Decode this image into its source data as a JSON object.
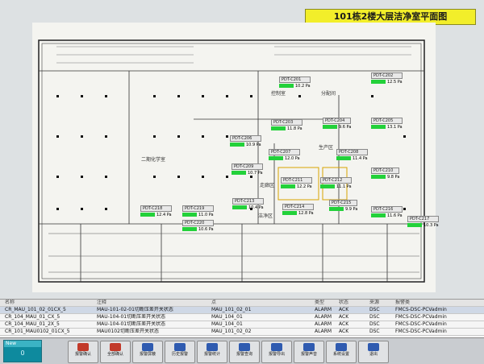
{
  "plan_title": "101栋2楼大层洁净室平面图",
  "rooms": [
    {
      "id": "r1",
      "label": "二期化学室"
    },
    {
      "id": "r2",
      "label": "控制室"
    },
    {
      "id": "r3",
      "label": "分配间"
    },
    {
      "id": "r4",
      "label": "生产区"
    },
    {
      "id": "r5",
      "label": "走廊区"
    },
    {
      "id": "r6",
      "label": "洁净区"
    }
  ],
  "sensors": [
    {
      "id": "PDT-C201",
      "value": "10.2 Pa"
    },
    {
      "id": "PDT-C202",
      "value": "12.5 Pa"
    },
    {
      "id": "PDT-C203",
      "value": "11.8 Pa"
    },
    {
      "id": "PDT-C204",
      "value": "9.6 Pa"
    },
    {
      "id": "PDT-C205",
      "value": "13.1 Pa"
    },
    {
      "id": "PDT-C206",
      "value": "10.9 Pa"
    },
    {
      "id": "PDT-C207",
      "value": "12.0 Pa"
    },
    {
      "id": "PDT-C208",
      "value": "11.4 Pa"
    },
    {
      "id": "PDT-C209",
      "value": "10.7 Pa"
    },
    {
      "id": "PDT-C210",
      "value": "9.8 Pa"
    },
    {
      "id": "PDT-C211",
      "value": "12.2 Pa"
    },
    {
      "id": "PDT-C212",
      "value": "11.1 Pa"
    },
    {
      "id": "PDT-C213",
      "value": "10.4 Pa"
    },
    {
      "id": "PDT-C214",
      "value": "12.8 Pa"
    },
    {
      "id": "PDT-C215",
      "value": "9.9 Pa"
    },
    {
      "id": "PDT-C216",
      "value": "11.6 Pa"
    },
    {
      "id": "PDT-C217",
      "value": "10.3 Pa"
    },
    {
      "id": "PDT-C218",
      "value": "12.4 Pa"
    },
    {
      "id": "PDT-C219",
      "value": "11.0 Pa"
    },
    {
      "id": "PDT-C220",
      "value": "10.6 Pa"
    }
  ],
  "alarm_table": {
    "columns": [
      "名称",
      "注释",
      "点",
      "",
      "类型",
      "状态",
      "来源",
      "报警类"
    ],
    "rows": [
      {
        "name": "CR_MAU_101_02_01CX_5",
        "comment": "MAU-101-02-01切断压差开关状态",
        "point": "MAU_101_02_01",
        "type": "ALARM",
        "status": "ACK",
        "source": "DSC",
        "cls": "FMCS-DSC-PCVadmin"
      },
      {
        "name": "CR_104_MAU_01_CX_5",
        "comment": "MAU-104-01切断压差开关状态",
        "point": "MAU_104_01",
        "type": "ALARM",
        "status": "ACK",
        "source": "DSC",
        "cls": "FMCS-DSC-PCVadmin"
      },
      {
        "name": "CR_104_MAU_01_2X_5",
        "comment": "MAU-104-01切断压差开关状态",
        "point": "MAU_104_01",
        "type": "ALARM",
        "status": "ACK",
        "source": "DSC",
        "cls": "FMCS-DSC-PCVadmin"
      },
      {
        "name": "CR_101_MAU0102_01CX_5",
        "comment": "MAU0102切断压差开关状态",
        "point": "MAU_101_02_02",
        "type": "ALARM",
        "status": "ACK",
        "source": "DSC",
        "cls": "FMCS-DSC-PCVadmin"
      }
    ]
  },
  "status_box": {
    "title": "New",
    "value": "0"
  },
  "toolbar": [
    {
      "label": "报警确认",
      "color": "#c23a2a"
    },
    {
      "label": "全部确认",
      "color": "#c23a2a"
    },
    {
      "label": "报警屏蔽",
      "color": "#2f5bb0"
    },
    {
      "label": "历史报警",
      "color": "#2f5bb0"
    },
    {
      "label": "报警统计",
      "color": "#2f5bb0"
    },
    {
      "label": "报警查询",
      "color": "#2f5bb0"
    },
    {
      "label": "报警导出",
      "color": "#2f5bb0"
    },
    {
      "label": "报警声音",
      "color": "#2f5bb0"
    },
    {
      "label": "系统设置",
      "color": "#2f5bb0"
    },
    {
      "label": "退出",
      "color": "#2f5bb0"
    }
  ]
}
